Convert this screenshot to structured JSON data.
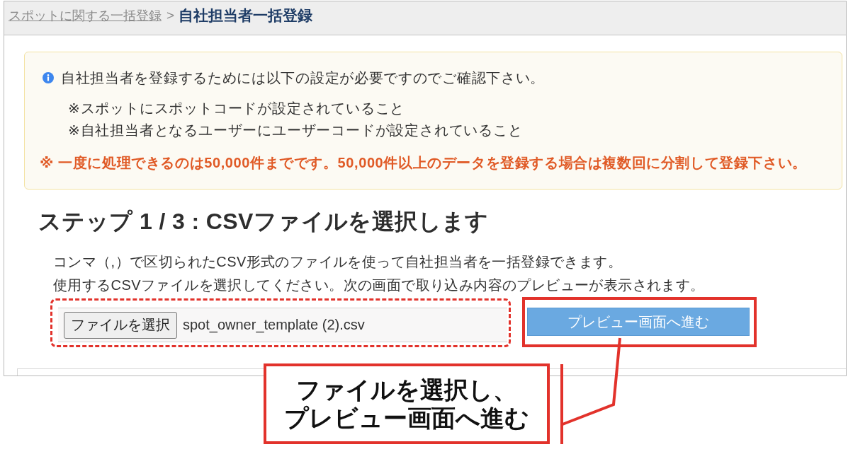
{
  "breadcrumb": {
    "parent_link": "スポットに関する一括登録",
    "separator": ">",
    "current": "自社担当者一括登録"
  },
  "notice": {
    "message": "自社担当者を登録するためには以下の設定が必要ですのでご確認下さい。",
    "requirements": [
      "※スポットにスポットコードが設定されていること",
      "※自社担当者となるユーザーにユーザーコードが設定されていること"
    ],
    "warning": "※ 一度に処理できるのは50,000件までです。50,000件以上のデータを登録する場合は複数回に分割して登録下さい。"
  },
  "step": {
    "heading": "ステップ 1 / 3 : CSVファイルを選択します",
    "description": [
      "コンマ（,）で区切られたCSV形式のファイルを使って自社担当者を一括登録できます。",
      "使用するCSVファイルを選択してください。次の画面で取り込み内容のプレビューが表示されます。"
    ]
  },
  "controls": [
    {
      "kind": "file_input",
      "button": "ファイルを選択",
      "value": "spot_owner_template (2).csv",
      "highlighted": true
    },
    {
      "kind": "button",
      "label": "プレビュー画面へ進む",
      "highlighted": true
    }
  ],
  "callout": {
    "lines": [
      "ファイルを選択し、",
      "プレビュー画面へ進む"
    ]
  }
}
